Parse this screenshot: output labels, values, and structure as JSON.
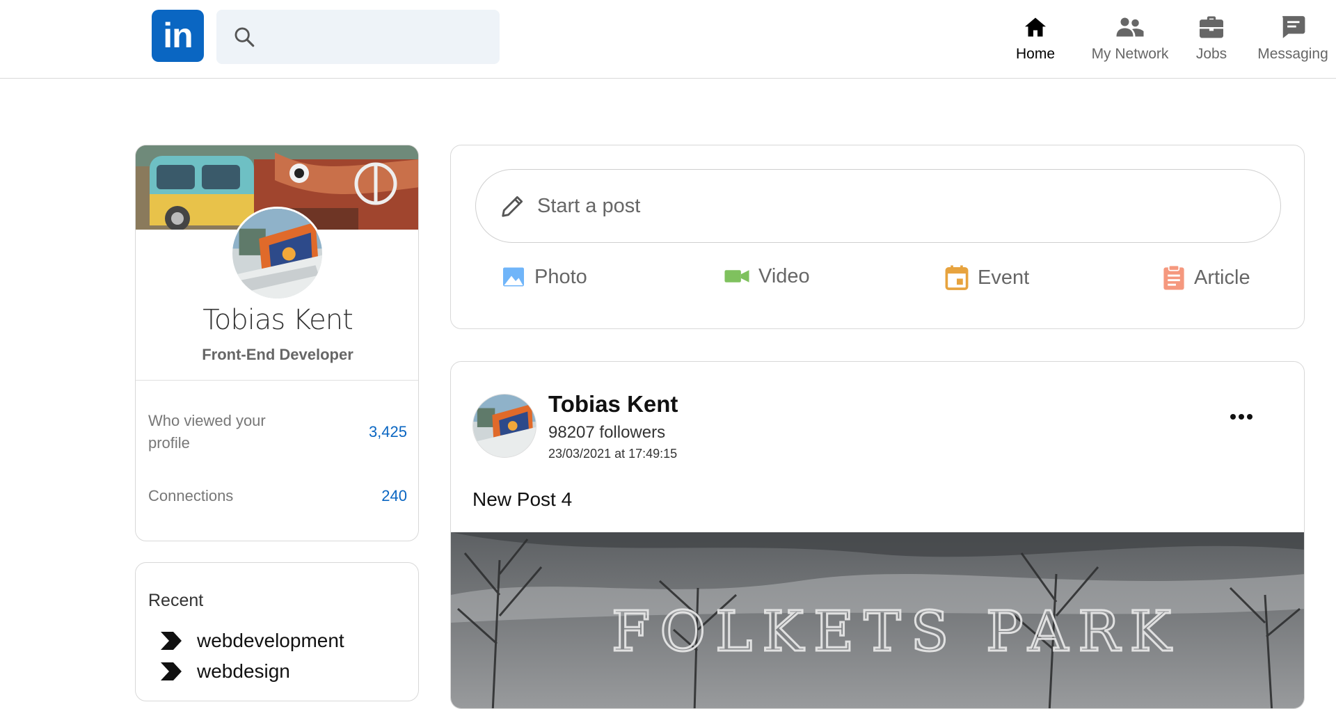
{
  "brand": {
    "logo_text": "in"
  },
  "search": {
    "placeholder": ""
  },
  "nav": [
    {
      "label": "Home",
      "icon": "home-icon",
      "active": true
    },
    {
      "label": "My Network",
      "icon": "network-icon",
      "active": false
    },
    {
      "label": "Jobs",
      "icon": "briefcase-icon",
      "active": false
    },
    {
      "label": "Messaging",
      "icon": "message-icon",
      "active": false
    }
  ],
  "profile": {
    "name": "Tobias Kent",
    "title": "Front-End Developer",
    "stats": [
      {
        "label": "Who viewed your profile",
        "value": "3,425"
      },
      {
        "label": "Connections",
        "value": "240"
      }
    ]
  },
  "recent": {
    "title": "Recent",
    "items": [
      "webdevelopment",
      "webdesign"
    ]
  },
  "composer": {
    "placeholder": "Start a post",
    "actions": [
      {
        "label": "Photo",
        "icon": "photo-icon",
        "color": "#70b5f9"
      },
      {
        "label": "Video",
        "icon": "video-icon",
        "color": "#7fc15e"
      },
      {
        "label": "Event",
        "icon": "event-icon",
        "color": "#e7a33e"
      },
      {
        "label": "Article",
        "icon": "article-icon",
        "color": "#f5987e"
      }
    ]
  },
  "post": {
    "author": "Tobias Kent",
    "followers": "98207 followers",
    "timestamp": "23/03/2021 at 17:49:15",
    "text": "New Post 4",
    "image_sign": "FOLKETS PARK"
  },
  "colors": {
    "accent": "#0a66c2",
    "border": "#d8d8d8",
    "search_bg": "#eef3f8"
  }
}
